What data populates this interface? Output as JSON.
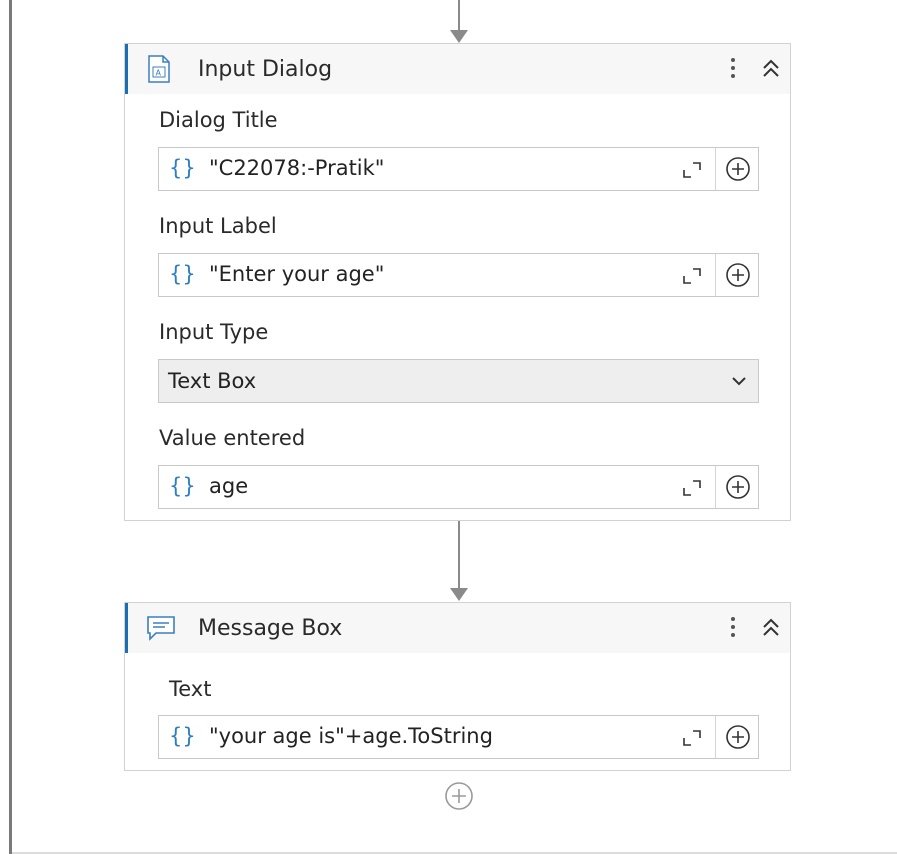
{
  "activities": [
    {
      "title": "Input Dialog",
      "icon": "input-dialog-icon",
      "fields": [
        {
          "label": "Dialog Title",
          "value": "\"C22078:-Pratik\""
        },
        {
          "label": "Input Label",
          "value": "\"Enter your age\""
        },
        {
          "label": "Input Type",
          "value": "Text Box"
        },
        {
          "label": "Value entered",
          "value": "age"
        }
      ]
    },
    {
      "title": "Message Box",
      "icon": "message-box-icon",
      "fields": [
        {
          "label": "Text",
          "value": "\"your age is\"+age.ToString"
        }
      ]
    }
  ],
  "expression_glyph": "{}",
  "colors": {
    "accent": "#1a6fb4",
    "braces": "#2f7fc0",
    "connector": "#8a8a8a"
  }
}
